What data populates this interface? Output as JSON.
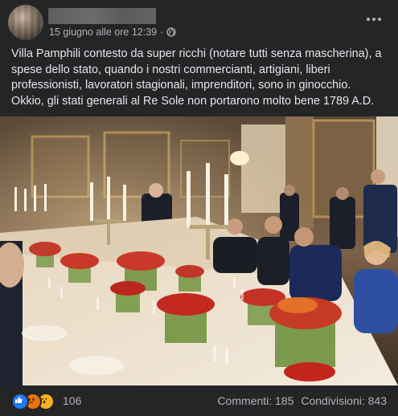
{
  "post": {
    "timestamp": "15 giugno alle ore 12:39",
    "separator": "·",
    "privacy_icon": "globe-icon",
    "more_icon": "more-options-icon",
    "text_lines": [
      "Villa Pamphili contesto da super ricchi (notare tutti senza mascherina), a spese dello stato, quando i nostri commercianti, artigiani, liberi professionisti, lavoratori stagionali, imprenditori, sono in ginocchio.",
      "Okkio, gli stati generali al Re Sole non portarono molto bene 1789 A.D."
    ]
  },
  "footer": {
    "reaction_icons": [
      "like-icon",
      "angry-icon",
      "wow-icon"
    ],
    "reaction_count": "106",
    "comments": "Commenti: 185",
    "shares": "Condivisioni: 843"
  },
  "colors": {
    "background": "#242526",
    "text": "#e4e6eb",
    "secondary_text": "#b0b3b8",
    "like": "#2078f4",
    "angry": "#e9710f",
    "wow": "#f7b125"
  }
}
